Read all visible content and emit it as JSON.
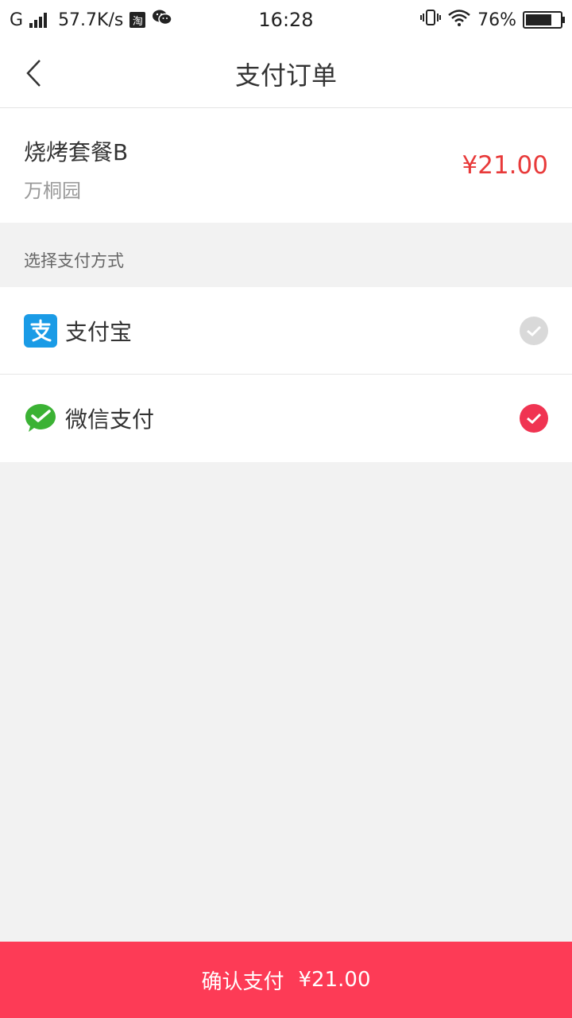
{
  "status_bar": {
    "network": "G",
    "speed": "57.7K/s",
    "taobao_glyph": "淘",
    "time": "16:28",
    "battery": "76%",
    "battery_level": 0.76
  },
  "nav": {
    "title": "支付订单"
  },
  "order": {
    "name": "烧烤套餐B",
    "shop": "万桐园",
    "price": "¥21.00"
  },
  "payment": {
    "section_label": "选择支付方式",
    "methods": [
      {
        "label": "支付宝",
        "icon": "alipay-icon",
        "selected": false,
        "color": "#1a9be6"
      },
      {
        "label": "微信支付",
        "icon": "wechat-pay-icon",
        "selected": true,
        "color": "#3bb234"
      }
    ]
  },
  "confirm": {
    "label": "确认支付",
    "amount": "¥21.00"
  },
  "colors": {
    "accent": "#fd3b56",
    "price": "#e83a3a"
  }
}
